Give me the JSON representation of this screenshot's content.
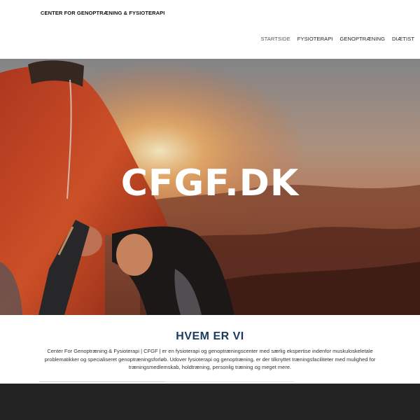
{
  "header": {
    "brand": "CENTER FOR GENOPTRÆNING  & FYSIOTERAPI"
  },
  "nav": {
    "items": [
      {
        "label": "STARTSIDE",
        "active": true
      },
      {
        "label": "FYSIOTERAPI",
        "active": false
      },
      {
        "label": "GENOPTRÆNING",
        "active": false
      },
      {
        "label": "DIÆTIST",
        "active": false
      }
    ]
  },
  "hero": {
    "title": "CFGF.DK"
  },
  "about": {
    "heading": "HVEM ER VI",
    "text": "Center For Genoptræning & Fysioterapi | CFGF | er en fysioterapi og genoptræningscenter med særlig ekspertise indenfor muskuloskeletale problematikker og specialiseret genoptræningsforløb. Udover fysioterapi og genoptræning, er der tilknyttet træningsfaciliteter med mulighed for træningsmedlemskab, holdtræning, personlig træning og meget mere."
  },
  "colors": {
    "heading": "#1b3a5c",
    "footer": "#232323",
    "hero_orange": "#d9552a"
  }
}
